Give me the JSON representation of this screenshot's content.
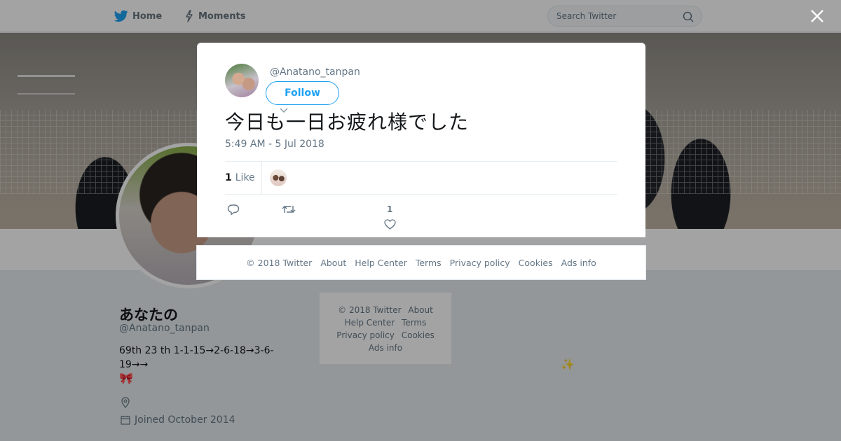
{
  "nav": {
    "home_label": "Home",
    "moments_label": "Moments",
    "search_placeholder": "Search Twitter"
  },
  "profile": {
    "name": "あなたの",
    "handle": "@Anatano_tanpan",
    "bio": "69th 23 th 1-1-15→2-6-18→3-6-19→→",
    "bio_emoji": "🎀",
    "joined": "Joined October 2014"
  },
  "side_footer": {
    "links": [
      "© 2018 Twitter",
      "About",
      "Help Center",
      "Terms",
      "Privacy policy",
      "Cookies",
      "Ads info"
    ]
  },
  "sparkle": "✨",
  "tweet": {
    "handle": "@Anatano_tanpan",
    "follow_label": "Follow",
    "text": "今日も一日お疲れ様でした",
    "timestamp": "5:49 AM - 5 Jul 2018",
    "like_count": "1",
    "like_label": "Like",
    "action_like_count": "1"
  },
  "modal_footer": {
    "links": [
      "© 2018 Twitter",
      "About",
      "Help Center",
      "Terms",
      "Privacy policy",
      "Cookies",
      "Ads info"
    ]
  },
  "colors": {
    "brand": "#1da1f2",
    "muted": "#657786",
    "text": "#14171a"
  },
  "icons": [
    "twitter-bird-icon",
    "lightning-icon",
    "search-icon",
    "close-icon",
    "reply-icon",
    "retweet-icon",
    "heart-icon",
    "location-icon",
    "calendar-icon",
    "chevron-down-icon"
  ]
}
